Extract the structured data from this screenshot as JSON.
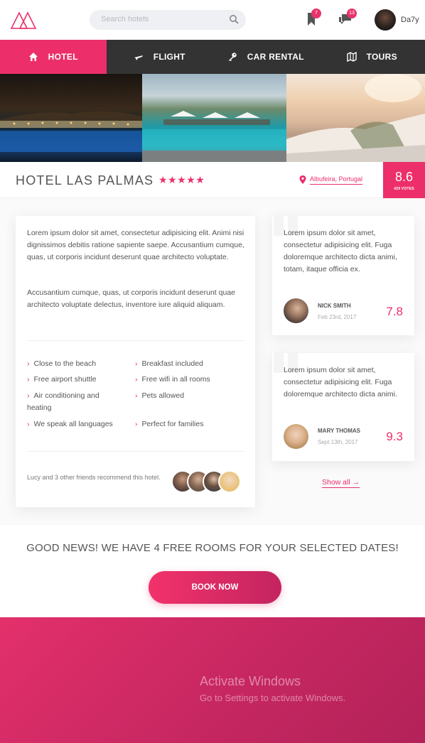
{
  "header": {
    "search_placeholder": "Search hotels",
    "bookmark_badge": "7",
    "messages_badge": "13",
    "username": "Da7y"
  },
  "nav": [
    {
      "label": "HOTEL",
      "icon": "home-icon",
      "active": true
    },
    {
      "label": "FLIGHT",
      "icon": "plane-icon",
      "active": false
    },
    {
      "label": "CAR RENTAL",
      "icon": "key-icon",
      "active": false
    },
    {
      "label": "TOURS",
      "icon": "map-icon",
      "active": false
    }
  ],
  "hotel": {
    "name": "HOTEL LAS PALMAS",
    "stars": "★★★★★",
    "star_count": 5,
    "location": "Albufeira, Portugal",
    "score": "8.6",
    "votes": "429 VOTES"
  },
  "description": {
    "paragraph1": "Lorem ipsum dolor sit amet, consectetur adipisicing elit. Animi nisi dignissimos debitis ratione sapiente saepe. Accusantium cumque, quas, ut corporis incidunt deserunt quae architecto voluptate.",
    "paragraph2": "Accusantium cumque, quas, ut corporis incidunt deserunt quae architecto voluptate delectus, inventore iure aliquid aliquam.",
    "amenities": [
      "Close to the beach",
      "Breakfast included",
      "Free airport shuttle",
      "Free wifi in all rooms",
      "Air conditioning and heating",
      "Pets allowed",
      "We speak all languages",
      "Perfect for families"
    ],
    "recommend": "Lucy and 3 other friends recommend this hotel."
  },
  "reviews": [
    {
      "text": "Lorem ipsum dolor sit amet, consectetur adipisicing elit. Fuga doloremque architecto dicta animi, totam, itaque officia ex.",
      "name": "NICK SMITH",
      "date": "Feb 23rd, 2017",
      "score": "7.8"
    },
    {
      "text": "Lorem ipsum dolor sit amet, consectetur adipisicing elit. Fuga doloremque architecto dicta animi.",
      "name": "MARY THOMAS",
      "date": "Sept 13th, 2017",
      "score": "9.3"
    }
  ],
  "show_all": "Show all →",
  "booking": {
    "message": "GOOD NEWS! WE HAVE 4 FREE ROOMS FOR YOUR SELECTED DATES!",
    "button": "BOOK NOW"
  },
  "watermark": {
    "line1": "Activate Windows",
    "line2": "Go to Settings to activate Windows."
  },
  "colors": {
    "accent": "#ec2f6a",
    "nav_bg": "#333333"
  }
}
